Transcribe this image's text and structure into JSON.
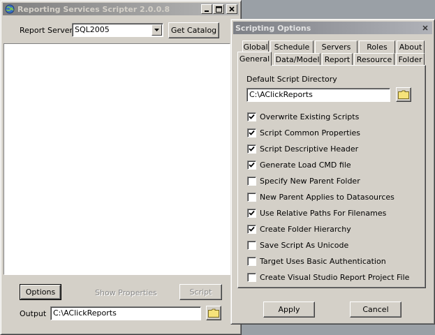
{
  "main_window": {
    "title": "Reporting Services Scripter 2.0.0.8",
    "report_server_label": "Report Server",
    "report_server_value": "SQL2005",
    "get_catalog_label": "Get Catalog",
    "options_label": "Options",
    "show_properties_label": "Show Properties",
    "script_label": "Script",
    "output_label": "Output",
    "output_value": "C:\\AClickReports"
  },
  "options_dialog": {
    "title": "Scripting Options",
    "tabs_top": [
      "Global",
      "Schedule",
      "Servers",
      "Roles",
      "About"
    ],
    "tabs_bottom": [
      "General",
      "Data/Model",
      "Report",
      "Resource",
      "Folder"
    ],
    "selected_tab": "General",
    "default_dir_label": "Default Script Directory",
    "default_dir_value": "C:\\AClickReports",
    "options": [
      {
        "label": "Overwrite Existing Scripts",
        "checked": true
      },
      {
        "label": "Script Common Properties",
        "checked": true
      },
      {
        "label": "Script Descriptive Header",
        "checked": true
      },
      {
        "label": "Generate Load CMD file",
        "checked": true
      },
      {
        "label": "Specify New Parent Folder",
        "checked": false
      },
      {
        "label": "New Parent Applies to Datasources",
        "checked": false
      },
      {
        "label": "Use Relative Paths For Filenames",
        "checked": true
      },
      {
        "label": "Create Folder Hierarchy",
        "checked": true
      },
      {
        "label": "Save Script As Unicode",
        "checked": false
      },
      {
        "label": "Target Uses Basic Authentication",
        "checked": false
      },
      {
        "label": "Create Visual Studio Report Project File",
        "checked": false
      }
    ],
    "apply_label": "Apply",
    "cancel_label": "Cancel"
  },
  "icons": {
    "app_icon": "app-globe-icon",
    "minimize": "minimize-icon",
    "maximize": "maximize-icon",
    "close": "close-icon",
    "folder": "folder-icon",
    "dropdown": "chevron-down-icon",
    "checkmark": "checkmark-icon"
  },
  "colors": {
    "face": "#d4d0c8",
    "desktop": "#9aa0a6",
    "folder_yellow": "#f6e27a"
  }
}
